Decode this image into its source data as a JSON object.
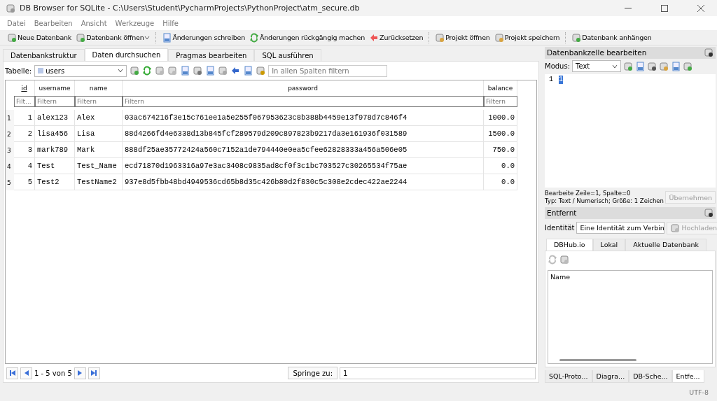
{
  "window": {
    "title": "DB Browser for SQLite - C:\\Users\\Student\\PycharmProjects\\PythonProject\\atm_secure.db"
  },
  "menu": [
    "Datei",
    "Bearbeiten",
    "Ansicht",
    "Werkzeuge",
    "Hilfe"
  ],
  "toolbar": [
    {
      "label": "Neue Datenbank",
      "kind": "db"
    },
    {
      "label": "Datenbank öffnen",
      "kind": "open"
    },
    {
      "label": "Änderungen schreiben",
      "kind": "save"
    },
    {
      "label": "Änderungen rückgängig machen",
      "kind": "revert"
    },
    {
      "label": "Zurücksetzen",
      "kind": "back"
    },
    {
      "label": "Projekt öffnen",
      "kind": "project"
    },
    {
      "label": "Projekt speichern",
      "kind": "project"
    },
    {
      "label": "Datenbank anhängen",
      "kind": "db"
    }
  ],
  "tabs": [
    {
      "label": "Datenbankstruktur",
      "selected": false
    },
    {
      "label": "Daten durchsuchen",
      "selected": true
    },
    {
      "label": "Pragmas bearbeiten",
      "selected": false
    },
    {
      "label": "SQL ausführen",
      "selected": false
    }
  ],
  "browse": {
    "table_label": "Tabelle:",
    "table": "users",
    "filter_placeholder": "In allen Spalten filtern",
    "columns": [
      {
        "label": "id",
        "kind": "number",
        "filter_placeholder": "Filt..."
      },
      {
        "label": "username",
        "kind": "text",
        "filter_placeholder": "Filtern"
      },
      {
        "label": "name",
        "kind": "text",
        "filter_placeholder": "Filtern"
      },
      {
        "label": "password",
        "kind": "text",
        "filter_placeholder": "Filtern"
      },
      {
        "label": "balance",
        "kind": "number",
        "filter_placeholder": "Filtern"
      }
    ],
    "rows": [
      {
        "number": "1",
        "cells": [
          "1",
          "alex123",
          "Alex",
          "03ac674216f3e15c761ee1a5e255f067953623c8b388b4459e13f978d7c846f4",
          "1000.0"
        ]
      },
      {
        "number": "2",
        "cells": [
          "2",
          "lisa456",
          "Lisa",
          "88d4266fd4e6338d13b845fcf289579d209c897823b9217da3e161936f031589",
          "1500.0"
        ]
      },
      {
        "number": "3",
        "cells": [
          "3",
          "mark789",
          "Mark",
          "888df25ae35772424a560c7152a1de794440e0ea5cfee62828333a456a506e05",
          "750.0"
        ]
      },
      {
        "number": "4",
        "cells": [
          "4",
          "Test",
          "Test_Name",
          "ecd71870d1963316a97e3ac3408c9835ad8cf0f3c1bc703527c30265534f75ae",
          "0.0"
        ]
      },
      {
        "number": "5",
        "cells": [
          "5",
          "Test2",
          "TestName2",
          "937e8d5fbb48bd4949536cd65b8d35c426b80d2f830c5c308e2cdec422ae2244",
          "0.0"
        ]
      }
    ],
    "pagination": {
      "range": "1 - 5 von 5",
      "jump_label": "Springe zu:",
      "jump_value": "1"
    }
  },
  "cell_editor": {
    "title": "Datenbankzelle bearbeiten",
    "mode_label": "Modus:",
    "mode": "Text",
    "line_number": "1",
    "content": "1",
    "info": [
      "Bearbeite Zeile=1, Spalte=0",
      "Typ: Text / Numerisch; Größe: 1 Zeichen"
    ],
    "apply": "Übernehmen"
  },
  "remote": {
    "title": "Entfernt",
    "identity_label": "Identität",
    "identity": "Eine Identität zum Verbin",
    "upload": "Hochladen",
    "tabs": [
      {
        "label": "DBHub.io",
        "selected": true
      },
      {
        "label": "Lokal",
        "selected": false
      },
      {
        "label": "Aktuelle Datenbank",
        "selected": false
      }
    ],
    "list_header": "Name"
  },
  "dock_tabs": [
    {
      "label": "SQL-Proto...",
      "selected": false
    },
    {
      "label": "Diagra...",
      "selected": false
    },
    {
      "label": "DB-Sche...",
      "selected": false
    },
    {
      "label": "Entfe...",
      "selected": true
    }
  ],
  "status": "UTF-8"
}
